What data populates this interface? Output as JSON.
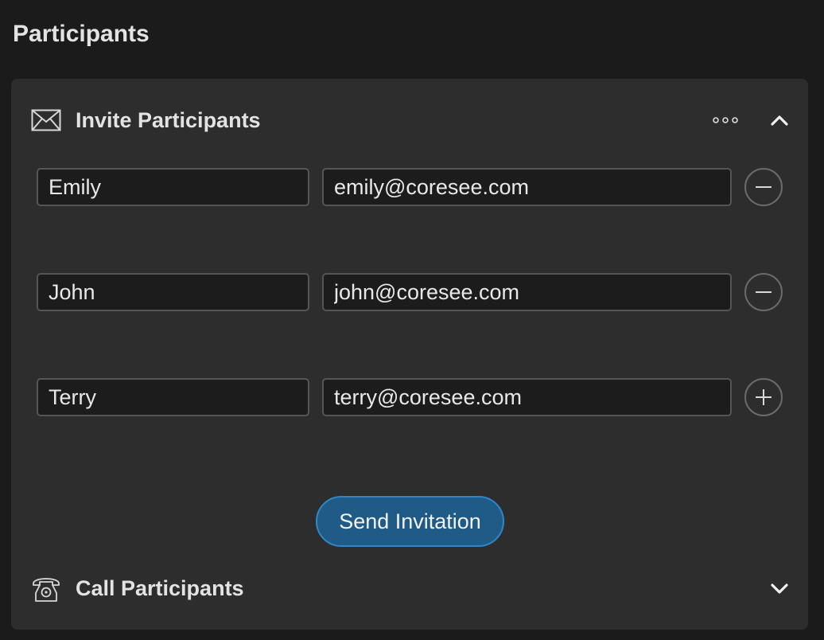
{
  "page": {
    "title": "Participants"
  },
  "invite_section": {
    "title": "Invite Participants",
    "icon": "envelope-icon",
    "more_icon": "more-options-icon",
    "toggle_icon": "chevron-up-icon",
    "rows": [
      {
        "name": "Emily",
        "email": "emily@coresee.com",
        "action_icon": "minus-circle-icon"
      },
      {
        "name": "John",
        "email": "john@coresee.com",
        "action_icon": "minus-circle-icon"
      },
      {
        "name": "Terry",
        "email": "terry@coresee.com",
        "action_icon": "plus-circle-icon"
      }
    ],
    "send_button_label": "Send Invitation"
  },
  "call_section": {
    "title": "Call Participants",
    "icon": "telephone-icon",
    "toggle_icon": "chevron-down-icon"
  },
  "colors": {
    "background": "#1b1b1b",
    "panel": "#2d2d2d",
    "field_background": "#1c1c1c",
    "field_border": "#555555",
    "accent_button": "#1f5b86",
    "accent_border": "#2f86c9"
  }
}
